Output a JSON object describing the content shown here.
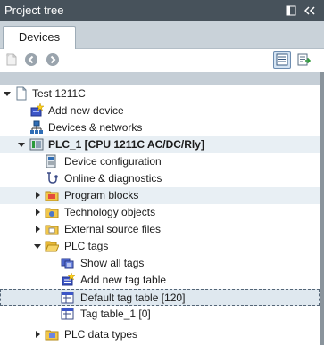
{
  "panel": {
    "title": "Project tree"
  },
  "tabs": [
    {
      "label": "Devices"
    }
  ],
  "tree": {
    "items": [
      {
        "label": "Test 1211C",
        "icon": "project-icon",
        "expander": "expanded"
      },
      {
        "label": "Add new device",
        "icon": "add-device-icon",
        "expander": "none"
      },
      {
        "label": "Devices & networks",
        "icon": "network-icon",
        "expander": "none"
      },
      {
        "label": "PLC_1 [CPU 1211C AC/DC/Rly]",
        "icon": "plc-icon",
        "expander": "expanded"
      },
      {
        "label": "Device configuration",
        "icon": "device-config-icon",
        "expander": "none"
      },
      {
        "label": "Online & diagnostics",
        "icon": "diagnostics-icon",
        "expander": "none"
      },
      {
        "label": "Program blocks",
        "icon": "folder-icon",
        "expander": "collapsed"
      },
      {
        "label": "Technology objects",
        "icon": "folder-icon",
        "expander": "collapsed"
      },
      {
        "label": "External source files",
        "icon": "folder-icon",
        "expander": "collapsed"
      },
      {
        "label": "PLC tags",
        "icon": "folder-open-icon",
        "expander": "expanded"
      },
      {
        "label": "Show all tags",
        "icon": "tags-icon",
        "expander": "none"
      },
      {
        "label": "Add new tag table",
        "icon": "add-tag-table-icon",
        "expander": "none"
      },
      {
        "label": "Default tag table [120]",
        "icon": "tag-table-icon",
        "expander": "none"
      },
      {
        "label": "Tag table_1 [0]",
        "icon": "tag-table-icon",
        "expander": "none"
      },
      {
        "label": "PLC data types",
        "icon": "folder-icon",
        "expander": "collapsed"
      }
    ]
  },
  "colors": {
    "title_bar": "#47525b",
    "tab_strip": "#c9d2d9",
    "row_stripe": "#e8eff4",
    "selection": "#dfe8ef"
  }
}
